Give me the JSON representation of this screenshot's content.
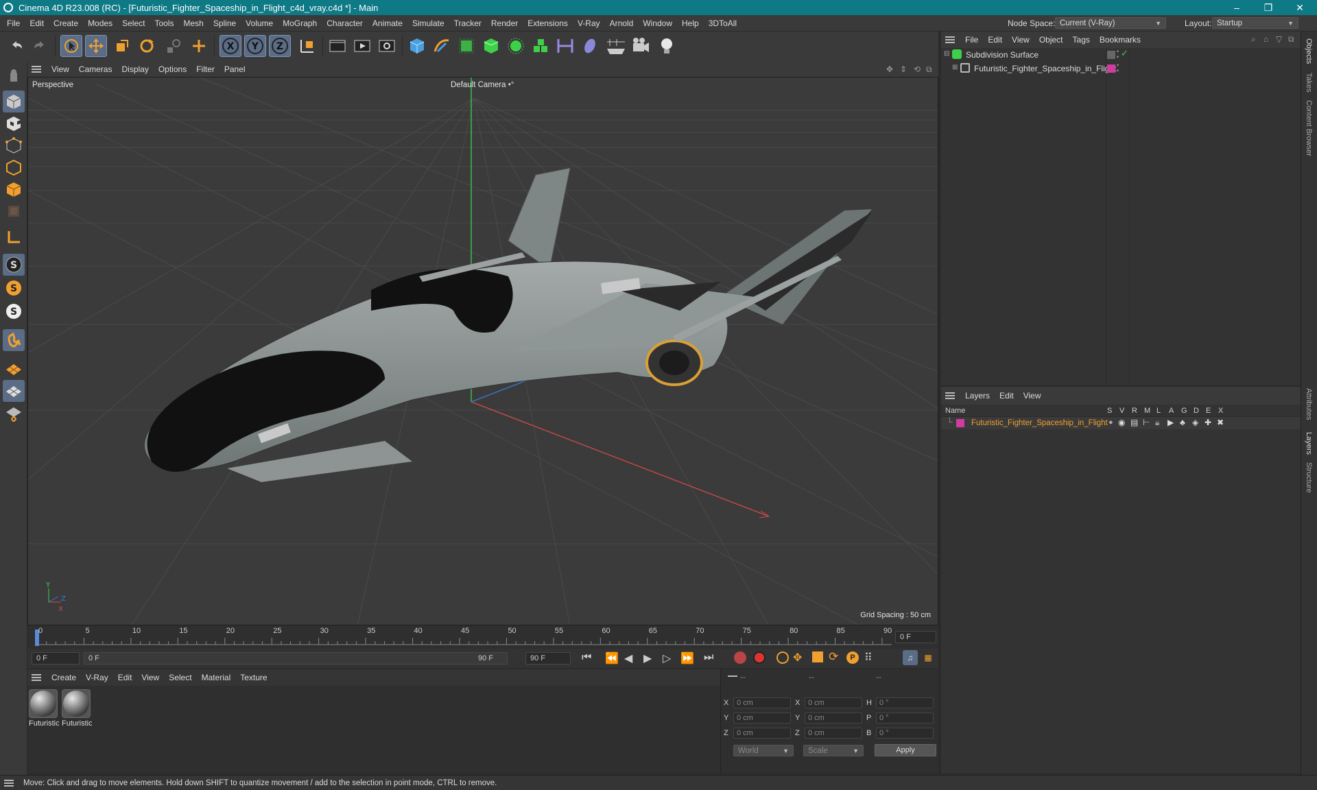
{
  "window": {
    "title": "Cinema 4D R23.008 (RC) - [Futuristic_Fighter_Spaceship_in_Flight_c4d_vray.c4d *] - Main",
    "minimize": "–",
    "restore": "❐",
    "close": "✕"
  },
  "menubar": {
    "items": [
      "File",
      "Edit",
      "Create",
      "Modes",
      "Select",
      "Tools",
      "Mesh",
      "Spline",
      "Volume",
      "MoGraph",
      "Character",
      "Animate",
      "Simulate",
      "Tracker",
      "Render",
      "Extensions",
      "V-Ray",
      "Arnold",
      "Window",
      "Help",
      "3DToAll"
    ],
    "node_space_label": "Node Space:",
    "node_space_value": "Current (V-Ray)",
    "layout_label": "Layout:",
    "layout_value": "Startup"
  },
  "toolbar": {
    "icons": [
      "undo-icon",
      "redo-icon",
      "live-selection-icon",
      "move-icon",
      "scale-icon",
      "rotate-icon",
      "recent-tools-icon",
      "add-icon",
      "x-axis-icon",
      "y-axis-icon",
      "z-axis-icon",
      "coordinate-system-icon",
      "render-view-icon",
      "render-picture-viewer-icon",
      "render-settings-icon",
      "cube-icon",
      "pen-icon",
      "subdivision-icon",
      "extrude-icon",
      "cloner-icon",
      "array-icon",
      "symmetry-icon",
      "deformer-icon",
      "floor-icon",
      "camera-icon",
      "light-icon"
    ],
    "axis_labels": [
      "X",
      "Y",
      "Z"
    ]
  },
  "left_tools": {
    "icons": [
      "make-editable-icon",
      "model-mode-icon",
      "texture-mode-icon",
      "points-mode-icon",
      "edges-mode-icon",
      "polygons-mode-icon",
      "uv-mode-icon",
      "axis-mode-icon",
      "snap-s-icon",
      "snap-s2-icon",
      "snap-s3-icon",
      "magnet-icon",
      "workplane-icon",
      "grid-icon",
      "quantize-icon"
    ],
    "snap_letter": "S"
  },
  "viewport": {
    "menu": [
      "View",
      "Cameras",
      "Display",
      "Options",
      "Filter",
      "Panel"
    ],
    "label": "Perspective",
    "camera": "Default Camera",
    "camera_suffix": "•°",
    "grid_spacing": "Grid Spacing : 50 cm",
    "axis_y": "Y",
    "axis_x": "X",
    "axis_z": "Z"
  },
  "timeline": {
    "ticks": [
      "0",
      "5",
      "10",
      "15",
      "20",
      "25",
      "30",
      "35",
      "40",
      "45",
      "50",
      "55",
      "60",
      "65",
      "70",
      "75",
      "80",
      "85",
      "90"
    ],
    "current_frame_right": "0 F",
    "start_field": "0 F",
    "range_start": "0 F",
    "range_end": "90 F",
    "end_field": "90 F"
  },
  "materials": {
    "menu": [
      "Create",
      "V-Ray",
      "Edit",
      "View",
      "Select",
      "Material",
      "Texture"
    ],
    "items": [
      {
        "label": "Futuristic"
      },
      {
        "label": "Futuristic"
      }
    ]
  },
  "coordinates": {
    "headers": [
      "--",
      "--",
      "--"
    ],
    "rows": [
      {
        "a": "X",
        "av": "0 cm",
        "b": "X",
        "bv": "0 cm",
        "c": "H",
        "cv": "0 °"
      },
      {
        "a": "Y",
        "av": "0 cm",
        "b": "Y",
        "bv": "0 cm",
        "c": "P",
        "cv": "0 °"
      },
      {
        "a": "Z",
        "av": "0 cm",
        "b": "Z",
        "bv": "0 cm",
        "c": "B",
        "cv": "0 °"
      }
    ],
    "world": "World",
    "scale": "Scale",
    "apply": "Apply"
  },
  "objects": {
    "menu": [
      "File",
      "Edit",
      "View",
      "Object",
      "Tags",
      "Bookmarks"
    ],
    "tree": [
      {
        "name": "Subdivision Surface"
      },
      {
        "name": "Futuristic_Fighter_Spaceship_in_Flight"
      }
    ]
  },
  "layers": {
    "menu": [
      "Layers",
      "Edit",
      "View"
    ],
    "columns": [
      "Name",
      "S",
      "V",
      "R",
      "M",
      "L",
      "A",
      "G",
      "D",
      "E",
      "X"
    ],
    "rows": [
      {
        "name": "Futuristic_Fighter_Spaceship_in_Flight",
        "color": "#d23ca0"
      }
    ]
  },
  "side_tabs": [
    "Objects",
    "Takes",
    "Content Browser",
    "Attributes",
    "Layers",
    "Structure"
  ],
  "status": "Move: Click and drag to move elements. Hold down SHIFT to quantize movement / add to the selection in point mode, CTRL to remove.",
  "colors": {
    "titlebar": "#0e7a86",
    "accent": "#5a6c86",
    "layer": "#d23ca0",
    "green_check": "#3fd04a"
  }
}
